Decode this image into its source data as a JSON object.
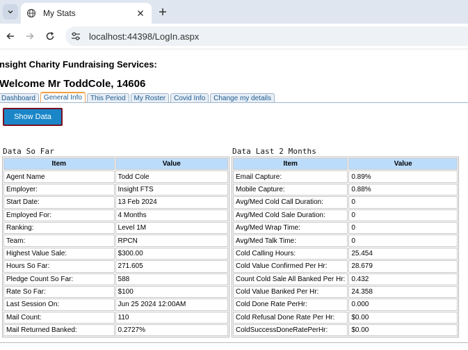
{
  "browser": {
    "tab_title": "My Stats",
    "url": "localhost:44398/LogIn.aspx"
  },
  "page": {
    "company": "nsight Charity Fundraising Services:",
    "welcome": "Welcome Mr ToddCole, 14606",
    "tabs": [
      "Dashboard",
      "General Info",
      "This Period",
      "My Roster",
      "Covid Info",
      "Change my details"
    ],
    "active_tab": "General Info",
    "show_button": "Show Data"
  },
  "left_table": {
    "title": "Data So Far",
    "headers": [
      "Item",
      "Value"
    ],
    "rows": [
      [
        "Agent Name",
        "Todd Cole"
      ],
      [
        "Employer:",
        "Insight FTS"
      ],
      [
        "Start Date:",
        "13 Feb 2024"
      ],
      [
        "Employed For:",
        "4 Months"
      ],
      [
        "Ranking:",
        "Level 1M"
      ],
      [
        "Team:",
        "RPCN"
      ],
      [
        "Highest Value Sale:",
        "$300.00"
      ],
      [
        "Hours So Far:",
        "271.605"
      ],
      [
        "Pledge Count So Far:",
        "588"
      ],
      [
        "Rate So Far:",
        "$100"
      ],
      [
        "Last Session On:",
        "Jun 25 2024 12:00AM"
      ],
      [
        "Mail Count:",
        "110"
      ],
      [
        "Mail Returned Banked:",
        "0.2727%"
      ]
    ]
  },
  "right_table": {
    "title": "Data Last 2 Months",
    "headers": [
      "Item",
      "Value"
    ],
    "rows": [
      [
        "Email Capture:",
        "0.89%"
      ],
      [
        "Mobile Capture:",
        "0.88%"
      ],
      [
        "Avg/Med Cold Call Duration:",
        "0"
      ],
      [
        "Avg/Med Cold Sale Duration:",
        "0"
      ],
      [
        "Avg/Med Wrap Time:",
        "0"
      ],
      [
        "Avg/Med Talk Time:",
        "0"
      ],
      [
        "Cold Calling Hours:",
        "25.454"
      ],
      [
        "Cold Value Confirmed Per Hr:",
        "28.679"
      ],
      [
        "Count Cold Sale All Banked Per Hr:",
        "0.432"
      ],
      [
        "Cold Value Banked Per Hr:",
        "24.358"
      ],
      [
        "Cold Done Rate PerHr:",
        "0.000"
      ],
      [
        "Cold Refusal Done Rate Per Hr:",
        "$0.00"
      ],
      [
        "ColdSuccessDoneRatePerHr:",
        "$0.00"
      ]
    ]
  },
  "colors": {
    "header_bg": "#bcdcfc",
    "button_bg": "#1a86c8",
    "tab_text": "#1c5c92",
    "active_tab_border": "#f0a040"
  }
}
